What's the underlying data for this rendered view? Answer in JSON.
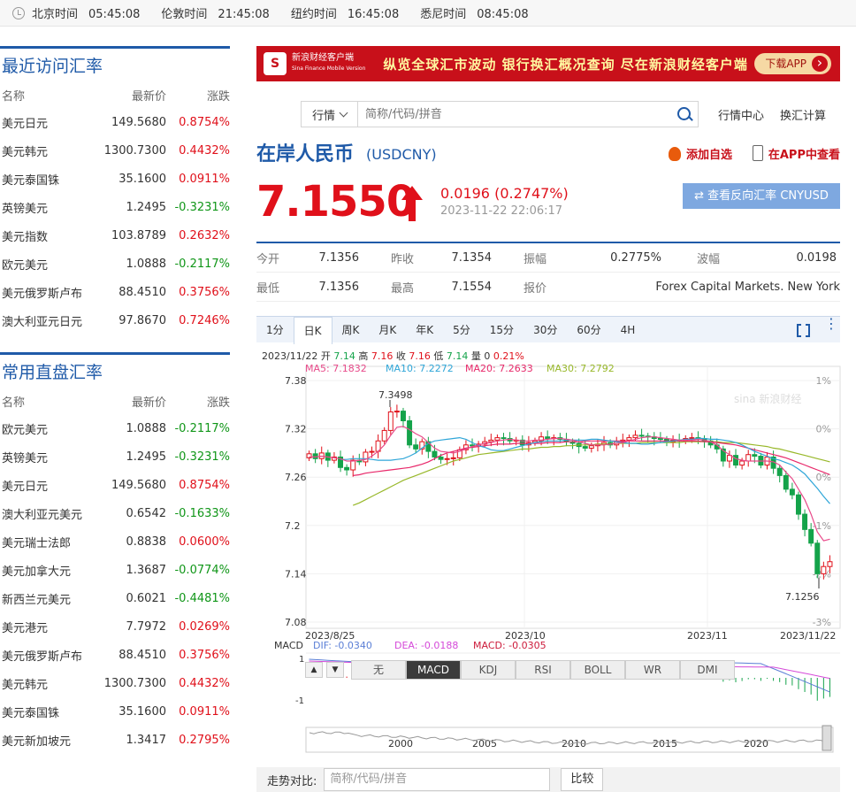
{
  "topbar": {
    "zones": [
      {
        "city": "北京时间",
        "time": "05:45:08"
      },
      {
        "city": "伦敦时间",
        "time": "21:45:08"
      },
      {
        "city": "纽约时间",
        "time": "16:45:08"
      },
      {
        "city": "悉尼时间",
        "time": "08:45:08"
      }
    ]
  },
  "recent": {
    "title": "最近访问汇率",
    "headers": [
      "名称",
      "最新价",
      "涨跌"
    ],
    "rows": [
      {
        "name": "美元日元",
        "price": "149.5680",
        "change": "0.8754%",
        "dir": "up"
      },
      {
        "name": "美元韩元",
        "price": "1300.7300",
        "change": "0.4432%",
        "dir": "up"
      },
      {
        "name": "美元泰国铢",
        "price": "35.1600",
        "change": "0.0911%",
        "dir": "up"
      },
      {
        "name": "英镑美元",
        "price": "1.2495",
        "change": "-0.3231%",
        "dir": "dn"
      },
      {
        "name": "美元指数",
        "price": "103.8789",
        "change": "0.2632%",
        "dir": "up"
      },
      {
        "name": "欧元美元",
        "price": "1.0888",
        "change": "-0.2117%",
        "dir": "dn"
      },
      {
        "name": "美元俄罗斯卢布",
        "price": "88.4510",
        "change": "0.3756%",
        "dir": "up"
      },
      {
        "name": "澳大利亚元日元",
        "price": "97.8670",
        "change": "0.7246%",
        "dir": "up"
      }
    ]
  },
  "common": {
    "title": "常用直盘汇率",
    "headers": [
      "名称",
      "最新价",
      "涨跌"
    ],
    "rows": [
      {
        "name": "欧元美元",
        "price": "1.0888",
        "change": "-0.2117%",
        "dir": "dn"
      },
      {
        "name": "英镑美元",
        "price": "1.2495",
        "change": "-0.3231%",
        "dir": "dn"
      },
      {
        "name": "美元日元",
        "price": "149.5680",
        "change": "0.8754%",
        "dir": "up"
      },
      {
        "name": "澳大利亚元美元",
        "price": "0.6542",
        "change": "-0.1633%",
        "dir": "dn"
      },
      {
        "name": "美元瑞士法郎",
        "price": "0.8838",
        "change": "0.0600%",
        "dir": "up"
      },
      {
        "name": "美元加拿大元",
        "price": "1.3687",
        "change": "-0.0774%",
        "dir": "dn"
      },
      {
        "name": "新西兰元美元",
        "price": "0.6021",
        "change": "-0.4481%",
        "dir": "dn"
      },
      {
        "name": "美元港元",
        "price": "7.7972",
        "change": "0.0269%",
        "dir": "up"
      },
      {
        "name": "美元俄罗斯卢布",
        "price": "88.4510",
        "change": "0.3756%",
        "dir": "up"
      },
      {
        "name": "美元韩元",
        "price": "1300.7300",
        "change": "0.4432%",
        "dir": "up"
      },
      {
        "name": "美元泰国铢",
        "price": "35.1600",
        "change": "0.0911%",
        "dir": "up"
      },
      {
        "name": "美元新加坡元",
        "price": "1.3417",
        "change": "0.2795%",
        "dir": "up"
      }
    ]
  },
  "banner": {
    "brand": "新浪财经客户端",
    "brand_en": "Sina Finance Mobile Version",
    "slogan": "纵览全球汇市波动  银行换汇概况查询  尽在新浪财经客户端",
    "button": "下载APP"
  },
  "search": {
    "select": "行情",
    "placeholder": "简称/代码/拼音",
    "links": [
      "行情中心",
      "换汇计算"
    ]
  },
  "quote": {
    "title": "在岸人民币",
    "code": "(USDCNY)",
    "fav": "添加自选",
    "app_view": "在APP中查看",
    "price": "7.1550",
    "change": "0.0196 (0.2747%)",
    "time": "2023-11-22 22:06:17",
    "reverse": "⇄ 查看反向汇率 CNYUSD",
    "accent": "#e0101a"
  },
  "stats": [
    [
      {
        "label": "今开",
        "value": "7.1356"
      },
      {
        "label": "昨收",
        "value": "7.1354"
      },
      {
        "label": "振幅",
        "value": "0.2775%"
      },
      {
        "label": "波幅",
        "value": "0.0198"
      }
    ],
    [
      {
        "label": "最低",
        "value": "7.1356"
      },
      {
        "label": "最高",
        "value": "7.1554"
      },
      {
        "label": "报价",
        "value": "Forex Capital Markets. New York"
      }
    ]
  ],
  "tabs": [
    "1分",
    "日K",
    "周K",
    "月K",
    "年K",
    "5分",
    "15分",
    "30分",
    "60分",
    "4H"
  ],
  "active_tab": "日K",
  "ohlc_line": {
    "date": "2023/11/22",
    "open_l": "开",
    "open": "7.14",
    "high_l": "高",
    "high": "7.16",
    "close_l": "收",
    "close": "7.16",
    "low_l": "低",
    "low": "7.14",
    "vol_l": "量",
    "vol": "0",
    "pct": "0.21%"
  },
  "ma_line": {
    "ma5": "MA5: 7.1832",
    "ma10": "MA10: 7.2272",
    "ma20": "MA20: 7.2633",
    "ma30": "MA30: 7.2792"
  },
  "macd_line": {
    "label": "MACD",
    "dif": "DIF: -0.0340",
    "dea": "DEA: -0.0188",
    "macd": "MACD: -0.0305"
  },
  "subtabs": [
    "无",
    "MACD",
    "KDJ",
    "RSI",
    "BOLL",
    "WR",
    "DMI"
  ],
  "active_subtab": "MACD",
  "nav_years": [
    "2000",
    "2005",
    "2010",
    "2015",
    "2020"
  ],
  "compare": {
    "label": "走势对比:",
    "placeholder": "简称/代码/拼音",
    "button": "比较"
  },
  "chart_data": {
    "type": "candlestick",
    "ylim": [
      7.08,
      7.38
    ],
    "y_ticks": [
      "7.38",
      "7.32",
      "7.26",
      "7.2",
      "7.14",
      "7.08"
    ],
    "right_ticks": [
      "1%",
      "0%",
      "0%",
      "-1%",
      "-2%",
      "-3%"
    ],
    "x_ticks": [
      "2023/8/25",
      "2023/10",
      "2023/11",
      "2023/11/22"
    ],
    "max_label": "7.3498",
    "min_label": "7.1256",
    "watermark": "sina 新浪财经",
    "closes": [
      7.289,
      7.283,
      7.29,
      7.281,
      7.285,
      7.272,
      7.269,
      7.281,
      7.279,
      7.291,
      7.292,
      7.305,
      7.318,
      7.341,
      7.342,
      7.33,
      7.3,
      7.295,
      7.304,
      7.292,
      7.285,
      7.282,
      7.283,
      7.284,
      7.294,
      7.3,
      7.299,
      7.301,
      7.304,
      7.306,
      7.309,
      7.308,
      7.305,
      7.306,
      7.3,
      7.303,
      7.305,
      7.31,
      7.308,
      7.309,
      7.307,
      7.304,
      7.302,
      7.298,
      7.296,
      7.299,
      7.301,
      7.303,
      7.3,
      7.304,
      7.306,
      7.309,
      7.312,
      7.311,
      7.31,
      7.308,
      7.307,
      7.304,
      7.306,
      7.305,
      7.308,
      7.309,
      7.308,
      7.305,
      7.3,
      7.295,
      7.28,
      7.287,
      7.275,
      7.28,
      7.288,
      7.286,
      7.275,
      7.285,
      7.271,
      7.262,
      7.245,
      7.238,
      7.214,
      7.195,
      7.178,
      7.14,
      7.149,
      7.155
    ],
    "ma5": [
      7.285,
      7.285,
      7.286,
      7.285,
      7.284,
      7.283,
      7.28,
      7.28,
      7.281,
      7.282,
      7.286,
      7.292,
      7.3,
      7.312,
      7.322,
      7.323,
      7.319,
      7.314,
      7.31,
      7.303,
      7.296,
      7.292,
      7.291,
      7.29,
      7.292,
      7.295,
      7.298,
      7.3,
      7.302,
      7.303,
      7.305,
      7.306,
      7.307,
      7.306,
      7.305,
      7.305,
      7.306,
      7.306,
      7.307,
      7.308,
      7.308,
      7.307,
      7.306,
      7.304,
      7.302,
      7.3,
      7.3,
      7.3,
      7.301,
      7.302,
      7.303,
      7.305,
      7.307,
      7.309,
      7.31,
      7.31,
      7.309,
      7.308,
      7.307,
      7.306,
      7.306,
      7.306,
      7.307,
      7.306,
      7.304,
      7.3,
      7.293,
      7.288,
      7.283,
      7.281,
      7.28,
      7.28,
      7.28,
      7.28,
      7.279,
      7.275,
      7.266,
      7.258,
      7.245,
      7.232,
      7.214,
      7.192,
      7.181,
      7.183
    ],
    "ma10": [
      7.282,
      7.282,
      7.283,
      7.283,
      7.283,
      7.282,
      7.281,
      7.281,
      7.281,
      7.282,
      7.283,
      7.286,
      7.29,
      7.296,
      7.302,
      7.305,
      7.306,
      7.307,
      7.308,
      7.309,
      7.307,
      7.303,
      7.299,
      7.297,
      7.294,
      7.293,
      7.293,
      7.295,
      7.297,
      7.299,
      7.301,
      7.303,
      7.304,
      7.305,
      7.305,
      7.305,
      7.306,
      7.306,
      7.306,
      7.306,
      7.307,
      7.307,
      7.306,
      7.305,
      7.304,
      7.303,
      7.302,
      7.302,
      7.301,
      7.301,
      7.302,
      7.303,
      7.304,
      7.305,
      7.306,
      7.307,
      7.307,
      7.308,
      7.308,
      7.307,
      7.307,
      7.306,
      7.305,
      7.303,
      7.3,
      7.296,
      7.292,
      7.289,
      7.286,
      7.283,
      7.281,
      7.278,
      7.275,
      7.27,
      7.264,
      7.255,
      7.246,
      7.236,
      7.227
    ],
    "ma20": [
      7.262,
      7.263,
      7.265,
      7.266,
      7.267,
      7.268,
      7.269,
      7.27,
      7.271,
      7.272,
      7.274,
      7.276,
      7.279,
      7.283,
      7.287,
      7.29,
      7.292,
      7.294,
      7.296,
      7.297,
      7.298,
      7.299,
      7.3,
      7.301,
      7.301,
      7.301,
      7.302,
      7.302,
      7.302,
      7.302,
      7.302,
      7.303,
      7.303,
      7.303,
      7.304,
      7.304,
      7.304,
      7.305,
      7.305,
      7.305,
      7.305,
      7.305,
      7.305,
      7.305,
      7.305,
      7.305,
      7.305,
      7.305,
      7.305,
      7.305,
      7.305,
      7.305,
      7.305,
      7.305,
      7.305,
      7.305,
      7.304,
      7.304,
      7.303,
      7.302,
      7.301,
      7.3,
      7.298,
      7.296,
      7.294,
      7.292,
      7.29,
      7.288,
      7.286,
      7.284,
      7.281,
      7.278,
      7.275,
      7.272,
      7.269,
      7.266,
      7.263
    ],
    "ma30": [
      7.225,
      7.228,
      7.232,
      7.236,
      7.24,
      7.244,
      7.248,
      7.252,
      7.256,
      7.259,
      7.262,
      7.265,
      7.268,
      7.271,
      7.274,
      7.277,
      7.28,
      7.282,
      7.284,
      7.286,
      7.288,
      7.289,
      7.29,
      7.291,
      7.292,
      7.293,
      7.294,
      7.295,
      7.295,
      7.296,
      7.297,
      7.297,
      7.298,
      7.298,
      7.299,
      7.299,
      7.3,
      7.3,
      7.3,
      7.301,
      7.301,
      7.301,
      7.302,
      7.302,
      7.302,
      7.302,
      7.303,
      7.303,
      7.303,
      7.303,
      7.303,
      7.303,
      7.303,
      7.304,
      7.304,
      7.304,
      7.304,
      7.304,
      7.304,
      7.303,
      7.303,
      7.303,
      7.302,
      7.301,
      7.3,
      7.299,
      7.298,
      7.296,
      7.295,
      7.293,
      7.291,
      7.289,
      7.287,
      7.285,
      7.283,
      7.281,
      7.279
    ],
    "colors": {
      "up": "#e0101a",
      "down": "#14a34a",
      "ma5": "#e84a8a",
      "ma10": "#2fa6d8",
      "ma20": "#e8286a",
      "ma30": "#98b82a",
      "dif": "#5b7fd6",
      "dea": "#d54ad9",
      "macd": "#cc1a3a"
    }
  }
}
